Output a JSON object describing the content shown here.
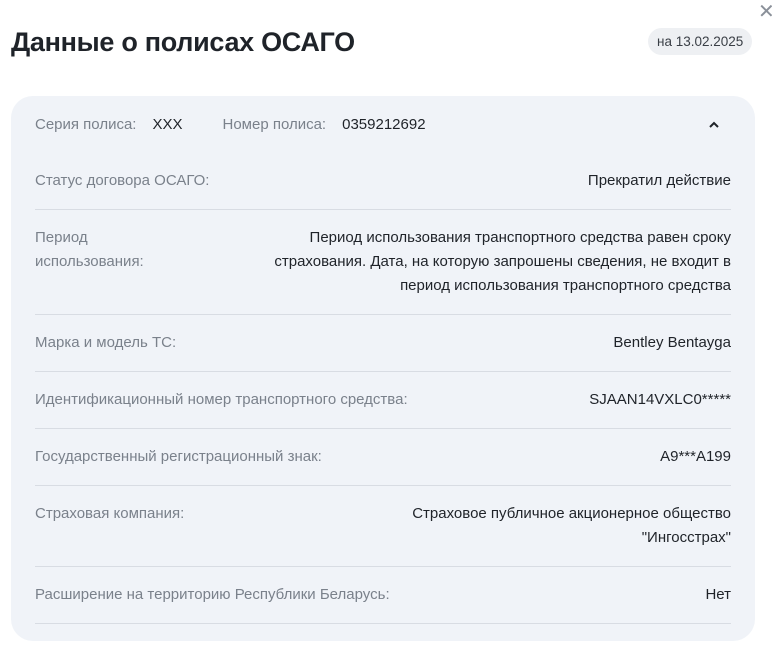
{
  "title": "Данные о полисах ОСАГО",
  "date_badge": "на 13.02.2025",
  "header": {
    "series_label": "Серия полиса:",
    "series_value": "XXX",
    "number_label": "Номер полиса:",
    "number_value": "0359212692"
  },
  "rows": [
    {
      "label": "Статус договора ОСАГО:",
      "value": "Прекратил действие"
    },
    {
      "label": "Период использования:",
      "value": "Период использования транспортного средства равен сроку страхования. Дата, на которую запрошены сведения, не входит в период использования транспортного средства"
    },
    {
      "label": "Марка и модель ТС:",
      "value": "Bentley Bentayga"
    },
    {
      "label": "Идентификационный номер транспортного средства:",
      "value": "SJAAN14VXLC0*****"
    },
    {
      "label": "Государственный регистрационный знак:",
      "value": "А9***А199"
    },
    {
      "label": "Страховая компания:",
      "value": "Страховое публичное акционерное общество \"Ингосстрах\""
    },
    {
      "label": "Расширение на территорию Республики Беларусь:",
      "value": "Нет"
    }
  ]
}
